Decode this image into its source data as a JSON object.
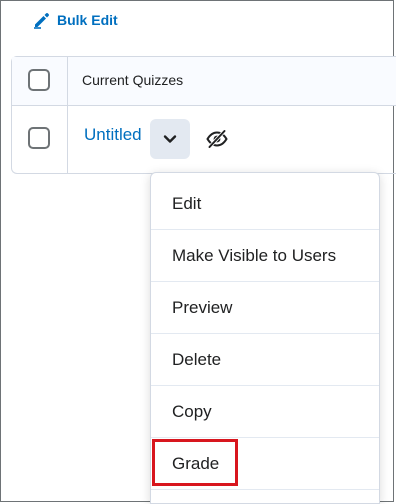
{
  "toolbar": {
    "bulk_edit_label": "Bulk Edit",
    "bulk_edit_icon": "pencil-icon",
    "accent_color": "#006fbf"
  },
  "table": {
    "column_header": "Current Quizzes",
    "rows": [
      {
        "name": "Untitled",
        "visibility_icon": "eye-slash-icon"
      }
    ]
  },
  "context_menu": {
    "items": [
      {
        "label": "Edit"
      },
      {
        "label": "Make Visible to Users"
      },
      {
        "label": "Preview"
      },
      {
        "label": "Delete"
      },
      {
        "label": "Copy"
      },
      {
        "label": "Grade"
      }
    ],
    "highlighted_item": "Grade",
    "highlight_color": "#d8161e"
  }
}
